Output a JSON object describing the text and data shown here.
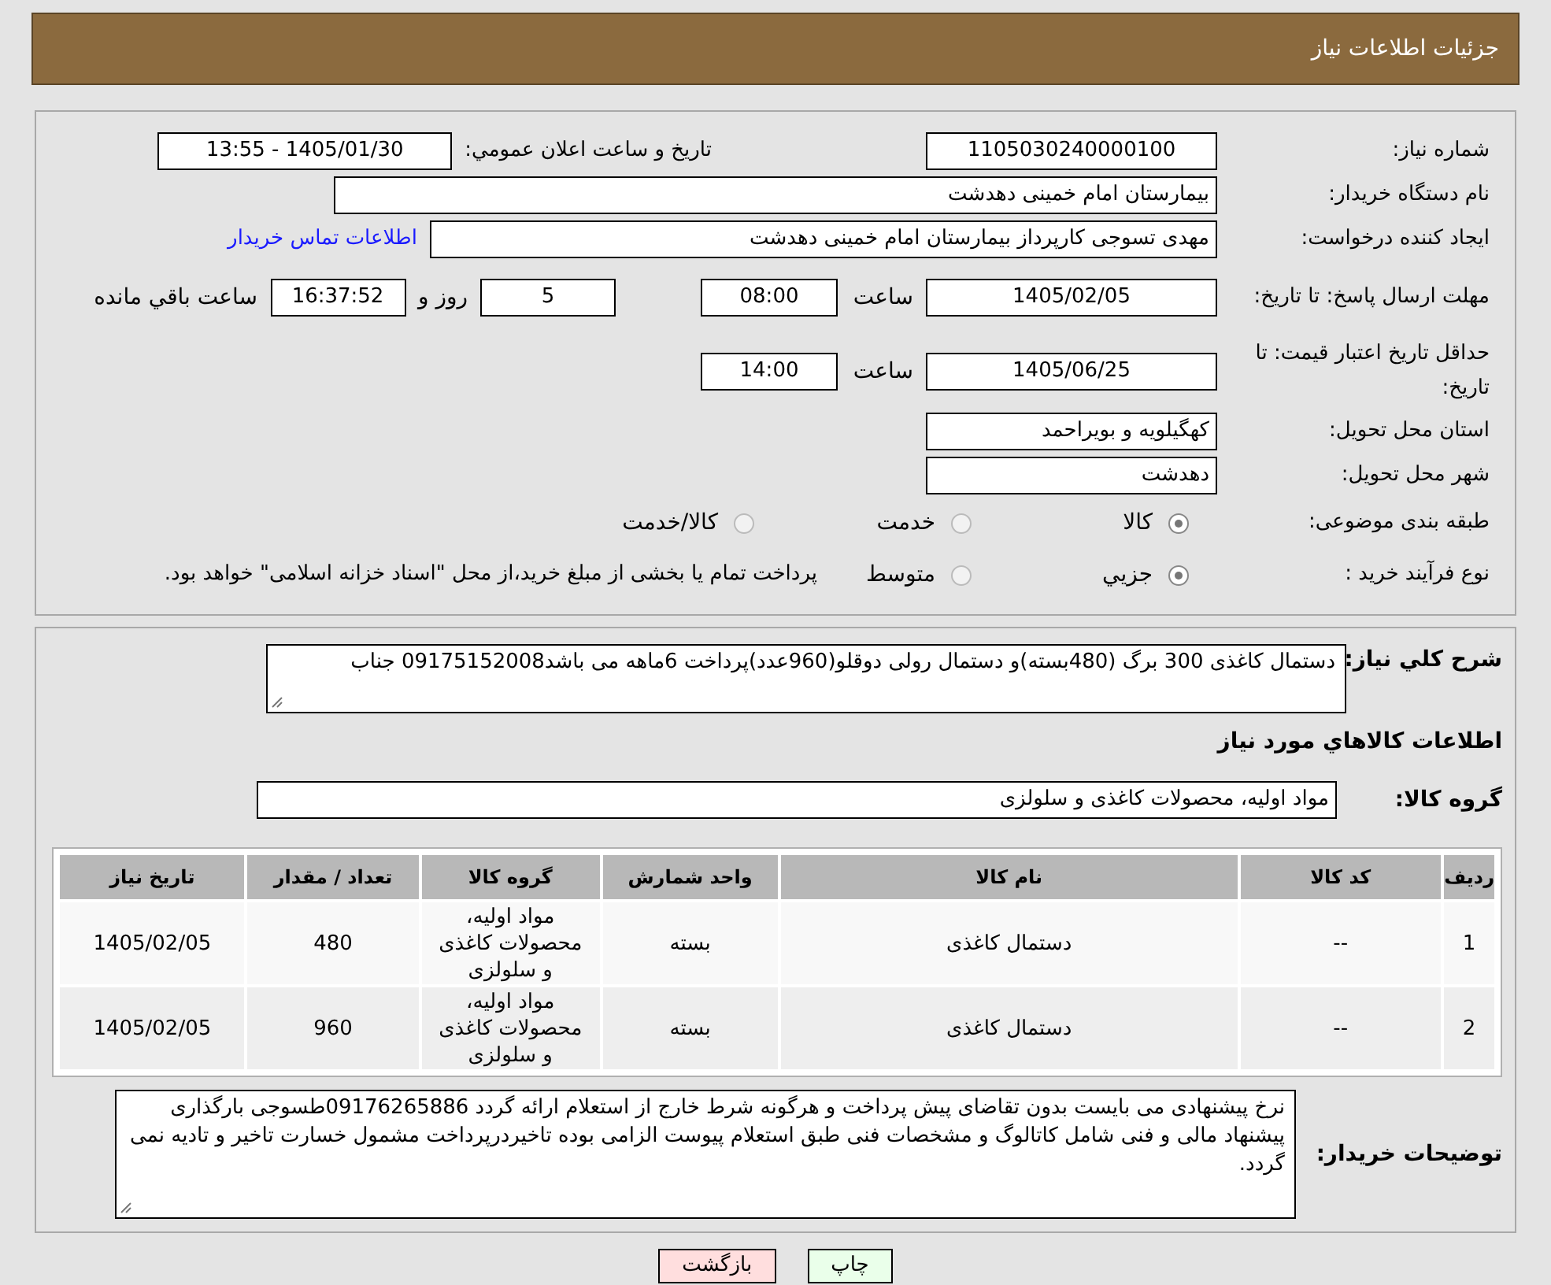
{
  "header": {
    "title": "جزئیات اطلاعات نیاز"
  },
  "need_number": {
    "label": "شماره نیاز:",
    "value": "1105030240000100"
  },
  "announce": {
    "label": "تاریخ و ساعت اعلان عمومي:",
    "value": "1405/01/30 - 13:55"
  },
  "buyer_org": {
    "label": "نام دستگاه خریدار:",
    "value": "بیمارستان امام خمینی دهدشت"
  },
  "requester": {
    "label": "ایجاد کننده درخواست:",
    "value": "مهدی تسوجی کارپرداز بیمارستان امام خمینی دهدشت",
    "link": "اطلاعات تماس خریدار"
  },
  "reply_deadline": {
    "label": "مهلت ارسال پاسخ: تا تاریخ:",
    "date": "1405/02/05",
    "time_label": "ساعت",
    "time": "08:00",
    "days": "5",
    "days_label": "روز و",
    "remaining": "16:37:52",
    "remaining_label": "ساعت باقي مانده"
  },
  "price_validity": {
    "label": "حداقل تاریخ اعتبار قیمت: تا تاریخ:",
    "date": "1405/06/25",
    "time_label": "ساعت",
    "time": "14:00"
  },
  "province": {
    "label": "استان محل تحویل:",
    "value": "کهگیلویه و بویراحمد"
  },
  "city": {
    "label": "شهر محل تحویل:",
    "value": "دهدشت"
  },
  "category": {
    "label": "طبقه بندی موضوعی:",
    "options": [
      {
        "label": "کالا",
        "selected": true
      },
      {
        "label": "خدمت",
        "selected": false
      },
      {
        "label": "کالا/خدمت",
        "selected": false
      }
    ]
  },
  "purchase_type": {
    "label": "نوع فرآیند خرید :",
    "options": [
      {
        "label": "جزيي",
        "selected": true
      },
      {
        "label": "متوسط",
        "selected": false
      }
    ],
    "note": "پرداخت تمام یا بخشی از مبلغ خرید،از محل \"اسناد خزانه اسلامی\" خواهد بود."
  },
  "description": {
    "label": "شرح کلي نیاز:",
    "value": "دستمال کاغذی 300 برگ (480بسته)و دستمال رولی دوقلو(960عدد)پرداخت 6ماهه می باشد09175152008 جناب"
  },
  "items_heading": "اطلاعات کالاهاي مورد نیاز",
  "goods_group": {
    "label": "گروه کالا:",
    "value": "مواد اولیه، محصولات کاغذی و سلولزی"
  },
  "table": {
    "columns": [
      "ردیف",
      "کد کالا",
      "نام کالا",
      "واحد شمارش",
      "گروه کالا",
      "تعداد / مقدار",
      "تاریخ نیاز"
    ],
    "rows": [
      [
        "1",
        "--",
        "دستمال کاغذی",
        "بسته",
        "مواد اولیه، محصولات کاغذی و سلولزی",
        "480",
        "1405/02/05"
      ],
      [
        "2",
        "--",
        "دستمال کاغذی",
        "بسته",
        "مواد اولیه، محصولات کاغذی و سلولزی",
        "960",
        "1405/02/05"
      ]
    ]
  },
  "buyer_notes": {
    "label": "توضیحات خریدار:",
    "value": "نرخ پیشنهادی می بایست بدون تقاضای پیش پرداخت و هرگونه شرط خارج از استعلام ارائه گردد 09176265886طسوجی بارگذاری پیشنهاد مالی و فنی شامل کاتالوگ و مشخصات فنی طبق استعلام پیوست الزامی بوده تاخیردرپرداخت مشمول خسارت تاخیر و تادیه نمی گردد."
  },
  "buttons": [
    {
      "label": "چاپ",
      "kind": "print"
    },
    {
      "label": "بازگشت",
      "kind": "back"
    }
  ]
}
